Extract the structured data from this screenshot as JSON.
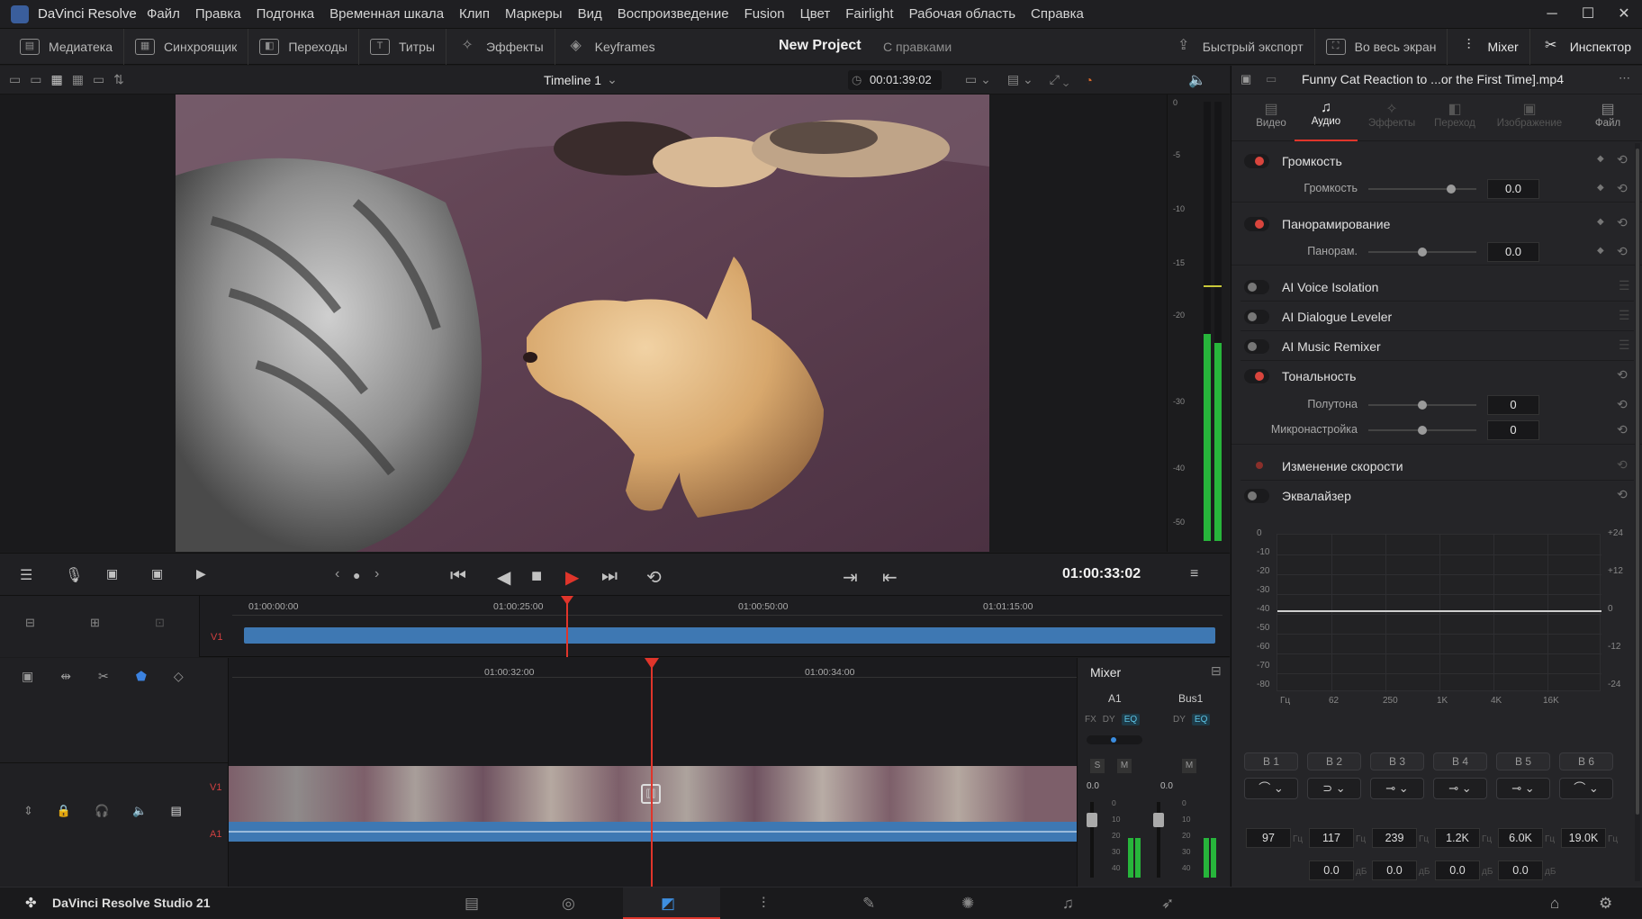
{
  "app": {
    "title": "DaVinci Resolve"
  },
  "menu": [
    "Файл",
    "Правка",
    "Подгонка",
    "Временная шкала",
    "Клип",
    "Маркеры",
    "Вид",
    "Воспроизведение",
    "Fusion",
    "Цвет",
    "Fairlight",
    "Рабочая область",
    "Справка"
  ],
  "toolbar": {
    "left": [
      "Медиатека",
      "Синхроящик",
      "Переходы",
      "Титры",
      "Эффекты",
      "Keyframes"
    ],
    "project_name": "New Project",
    "project_status": "С правками",
    "right": [
      "Быстрый экспорт",
      "Во весь экран",
      "Mixer",
      "Инспектор"
    ]
  },
  "viewer": {
    "timeline_name": "Timeline 1",
    "clip_timecode": "00:01:39:02",
    "current_timecode": "01:00:33:02"
  },
  "meter_scale": [
    "0",
    "-5",
    "-10",
    "-15",
    "-20",
    "-30",
    "-40",
    "-50"
  ],
  "ruler_upper": [
    "01:00:00:00",
    "01:00:25:00",
    "01:00:50:00",
    "01:01:15:00"
  ],
  "ruler_lower": [
    "01:00:32:00",
    "01:00:34:00"
  ],
  "tracks": {
    "v1": "V1",
    "a1": "A1"
  },
  "mixer": {
    "title": "Mixer",
    "channels": [
      "A1",
      "Bus1"
    ],
    "a1_buttons": [
      "FX",
      "DY",
      "EQ"
    ],
    "bus_buttons": [
      "DY",
      "EQ"
    ],
    "solo": "S",
    "mute": "M",
    "a1_level": "0.0",
    "bus_level": "0.0",
    "scale": [
      "0",
      "10",
      "20",
      "30",
      "40"
    ]
  },
  "inspector": {
    "clip_name": "Funny Cat Reaction to ...or the First Time].mp4",
    "tabs": [
      "Видео",
      "Аудио",
      "Эффекты",
      "Переход",
      "Изображение",
      "Файл"
    ],
    "active_tab": "Аудио",
    "volume": {
      "title": "Громкость",
      "label": "Громкость",
      "value": "0.0"
    },
    "pan": {
      "title": "Панорамирование",
      "label": "Панорам.",
      "value": "0.0"
    },
    "ai_voice": "AI Voice Isolation",
    "ai_dialogue": "AI Dialogue Leveler",
    "ai_music": "AI Music Remixer",
    "pitch": {
      "title": "Тональность",
      "semitones_label": "Полутона",
      "semitones": "0",
      "cents_label": "Микронастройка",
      "cents": "0"
    },
    "speed": "Изменение скорости",
    "eq": {
      "title": "Эквалайзер",
      "db_left": [
        "0",
        "-10",
        "-20",
        "-30",
        "-40",
        "-50",
        "-60",
        "-70",
        "-80"
      ],
      "db_right": [
        "+24",
        "+12",
        "0",
        "-12",
        "-24"
      ],
      "freq": [
        "Гц",
        "62",
        "250",
        "1K",
        "4K",
        "16K"
      ],
      "bands": [
        "B 1",
        "B 2",
        "B 3",
        "B 4",
        "B 5",
        "B 6"
      ],
      "band_shapes": [
        "⌒",
        "⊃",
        "⊸",
        "⊸",
        "⊸",
        "⌒"
      ],
      "freq_values": [
        "97",
        "117",
        "239",
        "1.2K",
        "6.0K",
        "19.0K"
      ],
      "freq_units": [
        "Гц",
        "Гц",
        "Гц",
        "Гц",
        "Гц",
        "Гц"
      ],
      "gain_values": [
        "0.0",
        "0.0",
        "0.0",
        "0.0"
      ],
      "gain_units": [
        "дБ",
        "дБ",
        "дБ",
        "дБ"
      ]
    }
  },
  "bottom": {
    "product": "DaVinci Resolve Studio 21"
  },
  "colors": {
    "accent_red": "#e0352b",
    "clip_blue": "#3e78b3",
    "meter_green": "#27b53b"
  }
}
